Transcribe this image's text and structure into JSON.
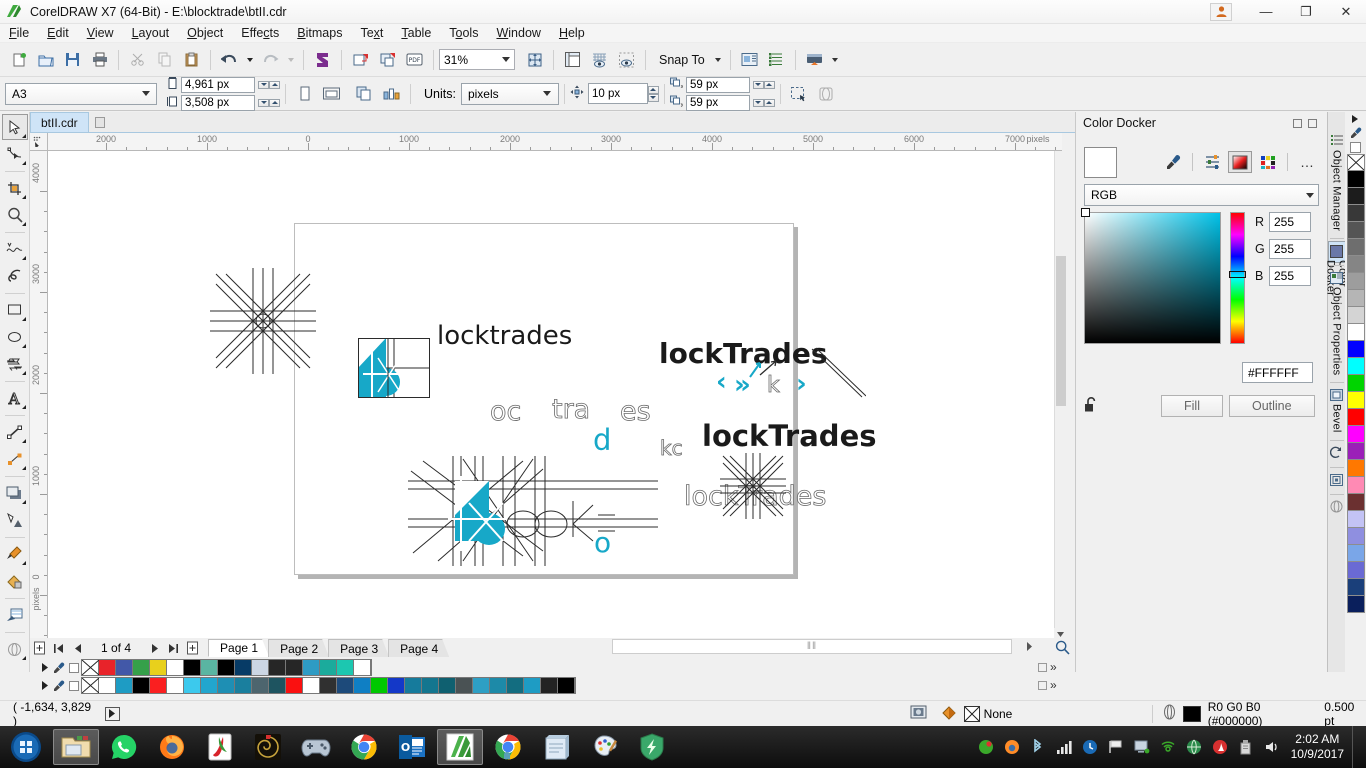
{
  "window": {
    "title": "CorelDRAW X7 (64-Bit) - E:\\blocktrade\\btII.cdr",
    "logo_icon": "coreldraw-logo-icon",
    "account_icon": "user-account-icon",
    "minimize_label": "—",
    "restore_label": "❐",
    "close_label": "✕"
  },
  "menubar": {
    "items": [
      {
        "label": "File",
        "accel": "F"
      },
      {
        "label": "Edit",
        "accel": "E"
      },
      {
        "label": "View",
        "accel": "V"
      },
      {
        "label": "Layout",
        "accel": "L"
      },
      {
        "label": "Object",
        "accel": "O"
      },
      {
        "label": "Effects",
        "accel": "c"
      },
      {
        "label": "Bitmaps",
        "accel": "B"
      },
      {
        "label": "Text",
        "accel": "x"
      },
      {
        "label": "Table",
        "accel": "T"
      },
      {
        "label": "Tools",
        "accel": "o"
      },
      {
        "label": "Window",
        "accel": "W"
      },
      {
        "label": "Help",
        "accel": "H"
      }
    ]
  },
  "toolbar": {
    "new_icon": "new-document-icon",
    "open_icon": "open-folder-icon",
    "save_icon": "save-disk-icon",
    "print_icon": "print-icon",
    "cut_icon": "scissors-cut-icon",
    "copy_icon": "copy-icon",
    "paste_icon": "paste-clipboard-icon",
    "undo_icon": "undo-arrow-icon",
    "undo_dropdown_icon": "chevron-down-icon",
    "redo_icon": "redo-arrow-icon",
    "redo_dropdown_icon": "chevron-down-icon",
    "corel_connect_icon": "corel-connect-icon",
    "import_icon": "import-icon",
    "export_icon": "export-icon",
    "publish_pdf_icon": "publish-to-pdf-icon",
    "zoom_level": "31%",
    "zoom_dropdown_icon": "chevron-down-icon",
    "fullscreen_icon": "full-screen-preview-icon",
    "rulers_icon": "show-rulers-icon",
    "grid_icon": "show-grid-icon",
    "guides_icon": "show-guidelines-icon",
    "snap_to_label": "Snap To",
    "snap_dropdown_icon": "chevron-down-icon",
    "options_icon": "options-icon",
    "object_manager_icon": "object-manager-icon",
    "app_launcher_icon": "application-launcher-icon",
    "app_launcher_dropdown_icon": "chevron-down-icon"
  },
  "propertybar": {
    "page_size": "A3",
    "page_size_dropdown_icon": "chevron-down-icon",
    "width_icon": "page-width-icon",
    "width_value": "4,961 px",
    "height_icon": "page-height-icon",
    "height_value": "3,508 px",
    "portrait_icon": "portrait-orientation-icon",
    "landscape_icon": "landscape-orientation-icon",
    "all_pages_icon": "apply-to-all-pages-icon",
    "current_page_icon": "apply-to-current-page-icon",
    "units_label": "Units:",
    "units_value": "pixels",
    "units_dropdown_icon": "chevron-down-icon",
    "nudge_icon": "nudge-offset-icon",
    "nudge_value": "10 px",
    "duplicate_x_icon": "duplicate-distance-x-icon",
    "duplicate_x_value": "59 px",
    "duplicate_y_icon": "duplicate-distance-y-icon",
    "duplicate_y_value": "59 px",
    "treat_as_filled_icon": "treat-all-objects-as-filled-icon",
    "wireframe_icon": "wireframe-icon"
  },
  "toolbox": {
    "tools": [
      {
        "name": "pick-tool",
        "icon": "pointer-arrow-icon",
        "active": true,
        "flyout": true
      },
      {
        "name": "shape-tool",
        "icon": "node-edit-shape-icon",
        "active": false,
        "flyout": true
      },
      {
        "name": "crop-tool",
        "icon": "crop-icon",
        "active": false,
        "flyout": true
      },
      {
        "name": "zoom-tool",
        "icon": "magnifier-icon",
        "active": false,
        "flyout": true
      },
      {
        "name": "freehand-tool",
        "icon": "freehand-curve-icon",
        "active": false,
        "flyout": true
      },
      {
        "name": "smart-drawing-tool",
        "icon": "smart-drawing-icon",
        "active": false,
        "flyout": false
      },
      {
        "name": "rectangle-tool",
        "icon": "rectangle-icon",
        "active": false,
        "flyout": true
      },
      {
        "name": "ellipse-tool",
        "icon": "ellipse-icon",
        "active": false,
        "flyout": true
      },
      {
        "name": "polygon-tool",
        "icon": "polygon-shapes-icon",
        "active": false,
        "flyout": true
      },
      {
        "name": "text-tool",
        "icon": "text-a-icon",
        "active": false,
        "flyout": true
      },
      {
        "name": "dimension-tool",
        "icon": "parallel-dimension-icon",
        "active": false,
        "flyout": true
      },
      {
        "name": "connector-tool",
        "icon": "straight-line-connector-icon",
        "active": false,
        "flyout": true
      },
      {
        "name": "shadow-tool",
        "icon": "drop-shadow-icon",
        "active": false,
        "flyout": true
      },
      {
        "name": "transparency-tool",
        "icon": "transparency-icon",
        "active": false,
        "flyout": false
      },
      {
        "name": "color-eyedropper-tool",
        "icon": "color-eyedropper-icon",
        "active": false,
        "flyout": true
      },
      {
        "name": "interactive-fill-tool",
        "icon": "interactive-fill-icon",
        "active": false,
        "flyout": false
      },
      {
        "name": "smart-fill-tool",
        "icon": "smart-fill-icon",
        "active": false,
        "flyout": false
      },
      {
        "name": "outline-tool",
        "icon": "outline-pen-icon",
        "active": false,
        "flyout": true
      }
    ]
  },
  "document_tabs": {
    "tabs": [
      {
        "label": "btII.cdr",
        "active": true
      }
    ],
    "new_tab_icon": "new-tab-icon"
  },
  "rulers": {
    "corner_icon": "ruler-origin-icon",
    "units_label": "pixels",
    "horizontal_ticks": [
      "2000",
      "1000",
      "0",
      "1000",
      "2000",
      "3000",
      "4000",
      "5000",
      "6000",
      "7000"
    ],
    "vertical_ticks": [
      "4000",
      "3000",
      "2000",
      "1000",
      "0"
    ]
  },
  "canvas": {
    "artwork": [
      {
        "name": "logo-mark-starburst-left",
        "kind": "starburst"
      },
      {
        "name": "logo-mark-grid-square",
        "kind": "grid-square"
      },
      {
        "name": "logo-text-locktrades-plain",
        "text": "locktrades"
      },
      {
        "name": "logo-text-lockTrades-bold-top",
        "text": "lockTrades"
      },
      {
        "name": "logo-text-lockTrades-bold-mid",
        "text": "lockTrades"
      },
      {
        "name": "logo-text-locktrades-outline-right",
        "text": "lockTrades"
      },
      {
        "name": "logo-text-oc-outline",
        "text": "oc"
      },
      {
        "name": "logo-text-tra-outline",
        "text": "tra"
      },
      {
        "name": "logo-text-es-outline",
        "text": "es"
      },
      {
        "name": "logo-text-d-cyan",
        "text": "d"
      },
      {
        "name": "logo-text-o-cyan",
        "text": "o"
      },
      {
        "name": "logo-text-kc-outline",
        "text": "kc"
      },
      {
        "name": "logo-text-k-outline-small",
        "text": "k"
      },
      {
        "name": "logo-text-lock-overlapped",
        "text": "lock"
      },
      {
        "name": "chevron-left-cyan",
        "text": "‹"
      },
      {
        "name": "chevron-double-right-cyan",
        "text": "»"
      },
      {
        "name": "chevron-right-cyan",
        "text": "›"
      },
      {
        "name": "diagonal-line-stroke",
        "kind": "line"
      }
    ]
  },
  "color_docker": {
    "title": "Color Docker",
    "minimize_icon": "docker-minimize-icon",
    "close_icon": "docker-close-icon",
    "current_color_swatch": "#FFFFFF",
    "eyedropper_icon": "eyedropper-icon",
    "sliders_icon": "color-sliders-icon",
    "viewers_icon": "color-viewers-icon",
    "palettes_icon": "color-palettes-icon",
    "more_icon": "more-options-icon",
    "color_model": "RGB",
    "model_dropdown_icon": "chevron-down-icon",
    "r_label": "R",
    "r_value": "255",
    "g_label": "G",
    "g_value": "255",
    "b_label": "B",
    "b_value": "255",
    "hex_value": "#FFFFFF",
    "lock_icon": "unlocked-padlock-icon",
    "fill_button": "Fill",
    "outline_button": "Outline"
  },
  "right_dockers": {
    "tabs": [
      {
        "label": "Object Manager",
        "icon": "object-manager-icon",
        "selected": false
      },
      {
        "label": "Color Docker",
        "icon": "color-swatch-icon",
        "selected": true
      },
      {
        "label": "Object Properties",
        "icon": "object-properties-icon",
        "selected": false
      },
      {
        "label": "Bevel",
        "icon": "bevel-icon",
        "selected": false
      },
      {
        "label": "",
        "icon": "transform-rotate-icon",
        "selected": false
      },
      {
        "label": "",
        "icon": "contour-icon",
        "selected": false
      },
      {
        "label": "",
        "icon": "transparency-docker-icon",
        "selected": false
      }
    ]
  },
  "right_palette": {
    "expand_icon": "palette-expand-arrow-icon",
    "eyedropper_icon": "palette-eyedropper-icon",
    "nofill_icon": "no-fill-icon",
    "scroll_down_icon": "palette-scroll-down-icon",
    "swatches": [
      "#000000",
      "#1c1c1c",
      "#383838",
      "#555555",
      "#6e6e6e",
      "#858585",
      "#9d9d9d",
      "#b5b5b5",
      "#d4d4d4",
      "#ffffff",
      "#0000ff",
      "#00ffff",
      "#00d400",
      "#ffff00",
      "#ff0000",
      "#ff00ff",
      "#9b1fb8",
      "#ff7800",
      "#ff8ab4",
      "#6b3030",
      "#c3c3f5",
      "#8f8fe0",
      "#7aa6e8",
      "#6a6ad4",
      "#1a3f7a",
      "#0a1f5c"
    ]
  },
  "pagebar": {
    "add_page_start_icon": "insert-page-before-icon",
    "first_icon": "first-page-icon",
    "prev_icon": "previous-page-icon",
    "counter": "1 of 4",
    "next_icon": "next-page-icon",
    "last_icon": "last-page-icon",
    "add_page_end_icon": "insert-page-after-icon",
    "pages": [
      {
        "label": "Page 1",
        "active": true
      },
      {
        "label": "Page 2",
        "active": false
      },
      {
        "label": "Page 3",
        "active": false
      },
      {
        "label": "Page 4",
        "active": false
      }
    ],
    "hscroll_grip": "‖‖",
    "zoom_icon": "zoom-to-fit-icon"
  },
  "doc_palette": {
    "expand_icon": "palette-arrow-icon",
    "eyedropper_icon": "palette-eyedropper-icon",
    "nofill_icon": "no-fill-x-icon",
    "overflow_icon": "palette-overflow-icon",
    "row1": [
      "#e8232a",
      "#4258a8",
      "#35a04a",
      "#e8d01c",
      "#ffffff",
      "#000000",
      "#5ab5a2",
      "#000000",
      "#073b66",
      "#ccd6e4",
      "#262626",
      "#262626",
      "#2e9bc4",
      "#1bab9c",
      "#1cc7b0",
      "#ffffff"
    ],
    "row2": [
      "#ffffff",
      "#1e9cc4",
      "#000000",
      "#fa1f20",
      "#ffffff",
      "#3cc9ed",
      "#22a6ce",
      "#1e8fb4",
      "#1a7f9e",
      "#4d656e",
      "#1e5460",
      "#fa1010",
      "#ffffff",
      "#303030",
      "#1d4a7a",
      "#0f7fc4",
      "#00c800",
      "#1438c8",
      "#167b9c",
      "#14768f",
      "#0f6070",
      "#4a5254",
      "#2e9fc4",
      "#1d8aa8",
      "#136d80",
      "#1e9cc4",
      "#232323",
      "#000000"
    ]
  },
  "statusbar": {
    "coordinates": "( -1,634, 3,829 )",
    "play_icon": "run-script-icon",
    "snapshot_icon": "snapshot-icon",
    "fill_icon": "fill-color-icon",
    "fill_value": "None",
    "outline_icon": "outline-pen-status-icon",
    "outline_color_hex": "#000000",
    "outline_value": "R0 G0 B0 (#000000)",
    "outline_width": "0.500 pt"
  },
  "taskbar": {
    "start_icon": "windows-start-orb-icon",
    "apps": [
      {
        "name": "file-explorer-icon",
        "active": true
      },
      {
        "name": "whatsapp-icon",
        "active": false
      },
      {
        "name": "firefox-icon",
        "active": false
      },
      {
        "name": "pdf-reader-icon",
        "active": false
      },
      {
        "name": "spiral-media-icon",
        "active": false
      },
      {
        "name": "game-controller-icon",
        "active": false
      },
      {
        "name": "google-chrome-icon",
        "active": false
      },
      {
        "name": "outlook-icon",
        "active": false
      },
      {
        "name": "coreldraw-icon",
        "active": true
      },
      {
        "name": "chrome-secondary-icon",
        "active": false
      },
      {
        "name": "notepad-icon",
        "active": false
      },
      {
        "name": "paint-icon",
        "active": false
      },
      {
        "name": "security-shield-icon",
        "active": false
      }
    ],
    "tray": [
      "green-pill-icon",
      "firefox-tray-icon",
      "bluetooth-icon",
      "signal-bars-icon",
      "clock-blue-icon",
      "flag-icon",
      "network-screen-icon",
      "wireless-icon",
      "globe-icon",
      "adobe-tray-icon",
      "usb-device-icon",
      "volume-speaker-icon"
    ],
    "time": "2:02 AM",
    "date": "10/9/2017"
  }
}
